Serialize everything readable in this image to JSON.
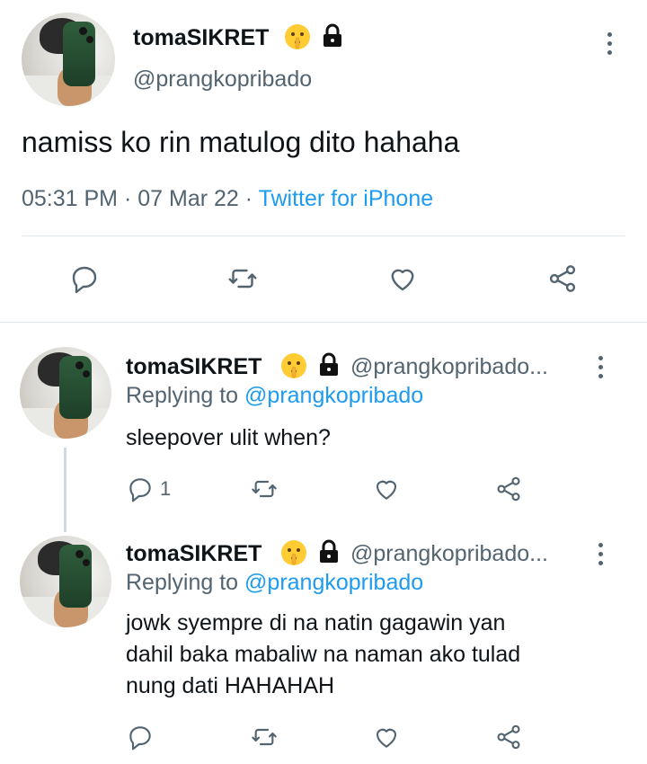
{
  "main_tweet": {
    "display_name": "tomaSIKRET",
    "handle": "@prangkopribado",
    "text": "namiss ko rin matulog dito hahaha",
    "time": "05:31 PM",
    "date": "07 Mar 22",
    "source": "Twitter for iPhone",
    "separator": "·"
  },
  "replies": [
    {
      "display_name": "tomaSIKRET",
      "handle": "@prangkopribado...",
      "replying_label": "Replying to",
      "replying_to": "@prangkopribado",
      "text": "sleepover ulit when?",
      "reply_count": "1"
    },
    {
      "display_name": "tomaSIKRET",
      "handle": "@prangkopribado...",
      "replying_label": "Replying to",
      "replying_to": "@prangkopribado",
      "text_lines": [
        "jowk syempre di na natin gagawin yan",
        "dahil baka mabaliw na naman ako tulad",
        "nung dati HAHAHAH"
      ]
    }
  ],
  "icons": [
    "shushing-face-emoji",
    "lock-icon",
    "more-vertical-icon",
    "reply-icon",
    "retweet-icon",
    "like-icon",
    "share-icon"
  ],
  "colors": {
    "link": "#1d9bf0",
    "secondary_text": "#536471",
    "divider": "#e1e8ed"
  }
}
